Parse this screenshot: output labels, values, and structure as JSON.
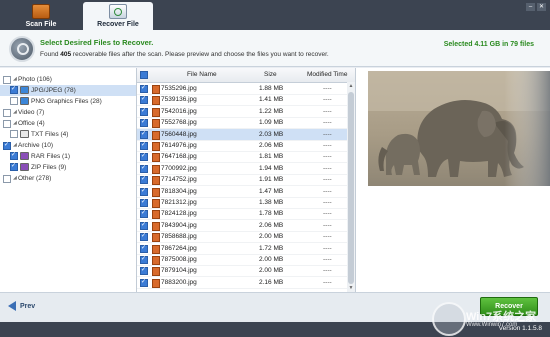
{
  "tabs": [
    {
      "label": "Scan File",
      "icon": "scan-file-icon"
    },
    {
      "label": "Recover File",
      "icon": "recover-file-icon",
      "active": true
    }
  ],
  "info": {
    "title": "Select Desired Files to Recover.",
    "sub_prefix": "Found",
    "found_count": "405",
    "sub_suffix": "recoverable files after the scan. Please preview and choose the files you want to recover.",
    "selected": "Selected 4.11 GB in 79 files"
  },
  "tree": [
    {
      "label": "Photo (106)",
      "level": 0,
      "checked": "partial"
    },
    {
      "label": "JPG/JPEG (78)",
      "level": 1,
      "checked": true,
      "selected": true
    },
    {
      "label": "PNG Graphics Files (28)",
      "level": 1,
      "checked": false
    },
    {
      "label": "Video (7)",
      "level": 0,
      "checked": false
    },
    {
      "label": "Office (4)",
      "level": 0,
      "checked": false
    },
    {
      "label": "TXT Files (4)",
      "level": 1,
      "checked": false
    },
    {
      "label": "Archive (10)",
      "level": 0,
      "checked": true
    },
    {
      "label": "RAR Files (1)",
      "level": 1,
      "checked": true
    },
    {
      "label": "ZIP Files (9)",
      "level": 1,
      "checked": true
    },
    {
      "label": "Other (278)",
      "level": 0,
      "checked": false
    }
  ],
  "table": {
    "headers": {
      "name": "File Name",
      "size": "Size",
      "modified": "Modified Time"
    },
    "rows": [
      {
        "name": "7535296.jpg",
        "size": "1.88 MB",
        "modified": "----"
      },
      {
        "name": "7539136.jpg",
        "size": "1.41 MB",
        "modified": "----"
      },
      {
        "name": "7542016.jpg",
        "size": "1.22 MB",
        "modified": "----"
      },
      {
        "name": "7552768.jpg",
        "size": "1.09 MB",
        "modified": "----"
      },
      {
        "name": "7560448.jpg",
        "size": "2.03 MB",
        "modified": "----",
        "selected": true
      },
      {
        "name": "7614976.jpg",
        "size": "2.06 MB",
        "modified": "----"
      },
      {
        "name": "7647168.jpg",
        "size": "1.81 MB",
        "modified": "----"
      },
      {
        "name": "7700992.jpg",
        "size": "1.94 MB",
        "modified": "----"
      },
      {
        "name": "7714752.jpg",
        "size": "1.91 MB",
        "modified": "----"
      },
      {
        "name": "7818304.jpg",
        "size": "1.47 MB",
        "modified": "----"
      },
      {
        "name": "7821312.jpg",
        "size": "1.38 MB",
        "modified": "----"
      },
      {
        "name": "7824128.jpg",
        "size": "1.78 MB",
        "modified": "----"
      },
      {
        "name": "7843904.jpg",
        "size": "2.06 MB",
        "modified": "----"
      },
      {
        "name": "7858688.jpg",
        "size": "2.00 MB",
        "modified": "----"
      },
      {
        "name": "7867264.jpg",
        "size": "1.72 MB",
        "modified": "----"
      },
      {
        "name": "7875008.jpg",
        "size": "2.00 MB",
        "modified": "----"
      },
      {
        "name": "7879104.jpg",
        "size": "2.00 MB",
        "modified": "----"
      },
      {
        "name": "7883200.jpg",
        "size": "2.16 MB",
        "modified": "----"
      }
    ]
  },
  "bottom": {
    "prev_label": "Prev",
    "recover_label": "Recover"
  },
  "status": {
    "version": "Version 1.1.5.8"
  },
  "watermark": {
    "text": "Win7系统之家",
    "url": "Www.Winwin7.com"
  }
}
